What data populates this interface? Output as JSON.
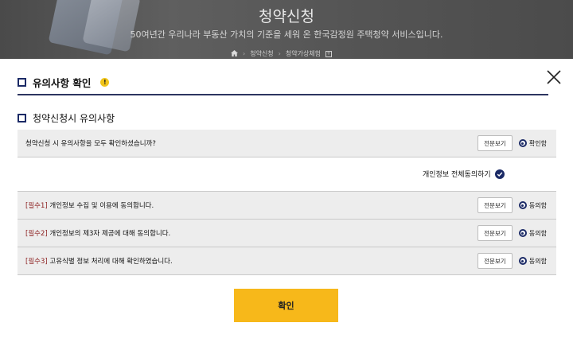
{
  "hero": {
    "title": "청약신청",
    "subtitle": "50여년간 우리나라 부동산 가치의 기준을 세워 온 한국감정원 주택청약 서비스입니다.",
    "breadcrumb": [
      "청약신청",
      "청약가상체험"
    ]
  },
  "modal": {
    "title": "유의사항 확인",
    "section_title": "청약신청시 유의사항",
    "confirm_row": {
      "text": "청약신청 시 유의사항을 모두 확인하셨습니까?",
      "view_label": "전문보기",
      "radio_label": "확인함"
    },
    "all_agree_label": "개인정보 전체동의하기",
    "consents": [
      {
        "prefix": "[필수1]",
        "text": " 개인정보 수집 및 이용에 동의합니다.",
        "view_label": "전문보기",
        "radio_label": "동의함"
      },
      {
        "prefix": "[필수2]",
        "text": " 개인정보의 제3자 제공에 대해 동의합니다.",
        "view_label": "전문보기",
        "radio_label": "동의함"
      },
      {
        "prefix": "[필수3]",
        "text": " 고유식별 정보 처리에 대해 확인하였습니다.",
        "view_label": "전문보기",
        "radio_label": "동의함"
      }
    ],
    "confirm_button": "확인"
  },
  "colors": {
    "accent_navy": "#1b2a66",
    "confirm_yellow": "#f7b81a",
    "required_red": "#8b1e1e",
    "row_gray": "#ededed"
  },
  "icons": [
    "warning-icon",
    "close-icon",
    "home-icon",
    "check-circle-icon",
    "square-bullet-icon"
  ]
}
